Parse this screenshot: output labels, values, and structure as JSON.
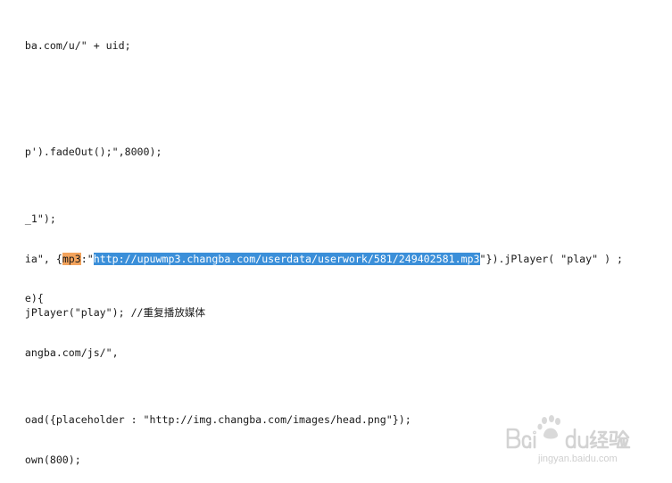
{
  "editor": {
    "lines": [
      {
        "segments": [
          {
            "text": "ba.com/u/\" + uid;",
            "style": "plain"
          }
        ]
      },
      {
        "segments": [
          {
            "text": "p').fadeOut();\",8000);",
            "style": "plain"
          }
        ]
      },
      {
        "segments": [
          {
            "text": "_1\");",
            "style": "plain"
          }
        ]
      },
      {
        "segments": [
          {
            "text": "ia\", {",
            "style": "plain"
          },
          {
            "text": "mp3",
            "style": "search-hit"
          },
          {
            "text": ":\"",
            "style": "plain"
          },
          {
            "text": "http://upuwmp3.changba.com/userdata/userwork/581/249402581.mp3",
            "style": "selection"
          },
          {
            "text": "\"}).jPlayer( \"play\" ) ;",
            "style": "plain"
          }
        ]
      },
      {
        "segments": [
          {
            "text": "e){",
            "style": "plain"
          }
        ]
      },
      {
        "segments": [
          {
            "text": "jPlayer(\"play\"); //重复播放媒体",
            "style": "plain"
          }
        ]
      },
      {
        "segments": [
          {
            "text": "angba.com/js/\",",
            "style": "plain"
          }
        ]
      },
      {
        "segments": [
          {
            "text": "oad({placeholder : \"http://img.changba.com/images/head.png\"});",
            "style": "plain"
          }
        ]
      },
      {
        "segments": [
          {
            "text": "own(800);",
            "style": "plain"
          }
        ]
      }
    ]
  },
  "watermark": {
    "caption": "jingyan.baidu.com",
    "logo_text": "Bai du 经验"
  },
  "colors": {
    "search_hit": "#f3a35c",
    "selection": "#3b8fd9",
    "text": "#1a1a1a",
    "watermark": "#cfcfcf"
  }
}
